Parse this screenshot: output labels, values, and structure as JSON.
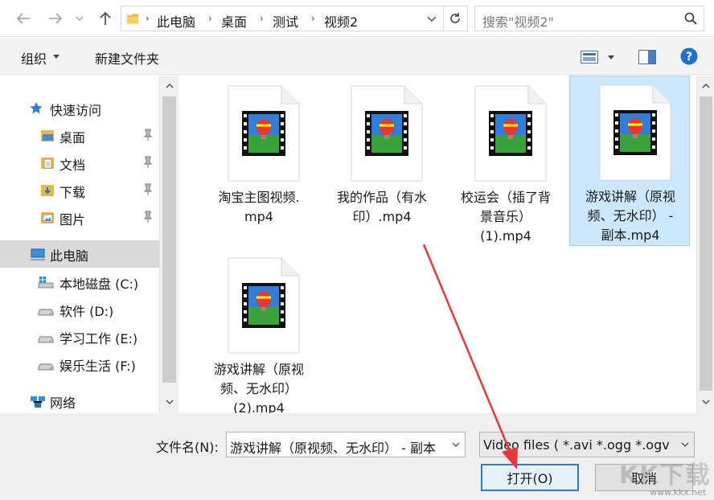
{
  "address": {
    "path": [
      "此电脑",
      "桌面",
      "测试",
      "视频2"
    ],
    "search_placeholder": "搜索\"视频2\""
  },
  "toolbar": {
    "organize": "组织",
    "new_folder": "新建文件夹"
  },
  "nav": {
    "quick_access": "快速访问",
    "desktop": "桌面",
    "documents": "文档",
    "downloads": "下载",
    "pictures": "图片",
    "this_pc": "此电脑",
    "drive_c": "本地磁盘 (C:)",
    "drive_d": "软件 (D:)",
    "drive_e": "学习工作 (E:)",
    "drive_f": "娱乐生活 (F:)",
    "network": "网络"
  },
  "files": [
    {
      "name": "淘宝主图视频.mp4",
      "lines": [
        "淘宝主图视频.",
        "mp4"
      ],
      "selected": false
    },
    {
      "name": "我的作品（有水印）.mp4",
      "lines": [
        "我的作品（有水",
        "印）.mp4"
      ],
      "selected": false
    },
    {
      "name": "校运会（插了背景音乐）(1).mp4",
      "lines": [
        "校运会（插了背",
        "景音乐）",
        "(1).mp4"
      ],
      "selected": false
    },
    {
      "name": "游戏讲解（原视频、无水印） - 副本.mp4",
      "lines": [
        "游戏讲解（原视",
        "频、无水印） -",
        "副本.mp4"
      ],
      "selected": true
    },
    {
      "name": "游戏讲解（原视频、无水印）(2).mp4",
      "lines": [
        "游戏讲解（原视",
        "频、无水印）",
        "(2).mp4"
      ],
      "selected": false
    }
  ],
  "bottom": {
    "filename_label": "文件名(N):",
    "filename_value": "游戏讲解（原视频、无水印） - 副本",
    "filetype_value": "Video files ( *.avi *.ogg *.ogv",
    "open_label": "打开(O)",
    "cancel_label": "取消"
  },
  "watermark": {
    "big": "KK下载",
    "small": "www.kkx.net"
  },
  "colors": {
    "selection": "#cce8ff",
    "nav_selected": "#d9d9d9",
    "annotation": "#e8373a",
    "help": "#1f6fd0"
  }
}
